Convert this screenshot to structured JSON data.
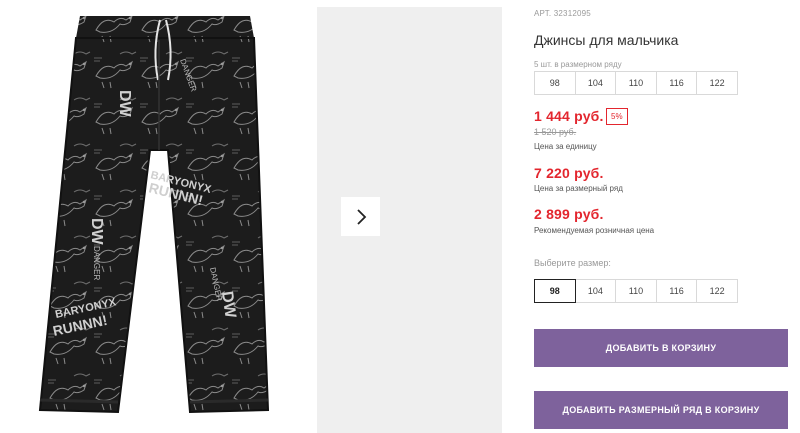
{
  "product": {
    "article": "АРТ. 32312095",
    "title": "Джинсы для мальчика",
    "pack_label": "5 шт. в размерном ряду",
    "pack_sizes": [
      "98",
      "104",
      "110",
      "116",
      "122"
    ],
    "price_unit": "1 444 руб.",
    "discount": "5%",
    "old_price": "1 520 руб.",
    "price_unit_caption": "Цена за единицу",
    "price_pack": "7 220 руб.",
    "price_pack_caption": "Цена за размерный ряд",
    "price_retail": "2 899 руб.",
    "price_retail_caption": "Рекомендуемая розничная цена",
    "choose_size_label": "Выберите размер:",
    "sizes": [
      "98",
      "104",
      "110",
      "116",
      "122"
    ],
    "selected_size": "98"
  },
  "buttons": {
    "add_to_cart": "ДОБАВИТЬ В КОРЗИНУ",
    "add_pack_to_cart": "ДОБАВИТЬ РАЗМЕРНЫЙ РЯД В КОРЗИНУ"
  },
  "gallery": {
    "next_icon": "chevron-right-icon",
    "print_text": [
      "BARYONYX",
      "RUNNN!",
      "DANGER",
      "DW"
    ]
  },
  "colors": {
    "accent_price": "#e3262e",
    "button": "#7e629c"
  }
}
